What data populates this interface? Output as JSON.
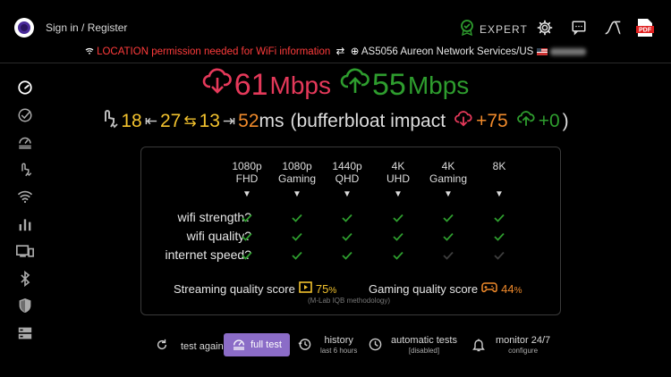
{
  "header": {
    "signin_label": "Sign in / Register",
    "expert_label": "EXPERT",
    "icons": [
      "app-logo",
      "expert-badge-icon",
      "gear-icon",
      "chat-icon",
      "curve-icon",
      "pdf-icon"
    ]
  },
  "status": {
    "location_warning": "LOCATION permission needed for WiFi information",
    "network": "AS5056 Aureon Network Services/US"
  },
  "sidebar": {
    "items": [
      "speed-gauge-icon",
      "check-circle-icon",
      "gauge-lines-icon",
      "ping-hand-icon",
      "wifi-icon",
      "bar-chart-icon",
      "devices-icon",
      "bluetooth-icon",
      "shield-icon",
      "server-icon"
    ]
  },
  "speeds": {
    "download_value": "61",
    "download_unit": "Mbps",
    "upload_value": "55",
    "upload_unit": "Mbps"
  },
  "latency": {
    "idle": "18",
    "loaded": "27",
    "jitter": "13",
    "ping": "52",
    "unit": "ms",
    "bufferbloat_label": "(bufferbloat impact",
    "down_impact": "+75",
    "up_impact": "+0",
    "close": ")"
  },
  "quality": {
    "columns": [
      {
        "l1": "1080p",
        "l2": "FHD"
      },
      {
        "l1": "1080p",
        "l2": "Gaming"
      },
      {
        "l1": "1440p",
        "l2": "QHD"
      },
      {
        "l1": "4K",
        "l2": "UHD"
      },
      {
        "l1": "4K",
        "l2": "Gaming"
      },
      {
        "l1": "8K",
        "l2": ""
      }
    ],
    "rows": [
      {
        "label": "wifi strength?",
        "checks": [
          true,
          true,
          true,
          true,
          true,
          true
        ]
      },
      {
        "label": "wifi quality?",
        "checks": [
          true,
          true,
          true,
          true,
          true,
          true
        ]
      },
      {
        "label": "internet speed?",
        "checks": [
          true,
          true,
          true,
          true,
          false,
          false
        ]
      }
    ],
    "streaming_label": "Streaming quality score",
    "streaming_value": "75",
    "gaming_label": "Gaming quality score",
    "gaming_value": "44",
    "percent": "%",
    "methodology": "(M-Lab IQB methodology)"
  },
  "actions": {
    "test_again": "test again",
    "full_test": "full test",
    "history": "history",
    "history_sub": "last 6 hours",
    "automatic_tests": "automatic tests",
    "automatic_sub": "[disabled]",
    "monitor": "monitor 24/7",
    "monitor_sub": "configure"
  },
  "colors": {
    "download": "#e5395a",
    "upload": "#2e9d2e",
    "yellow": "#f2c22e",
    "orange": "#f08a2b",
    "accent": "#8b6cc7",
    "warning": "#ff3b3b"
  }
}
